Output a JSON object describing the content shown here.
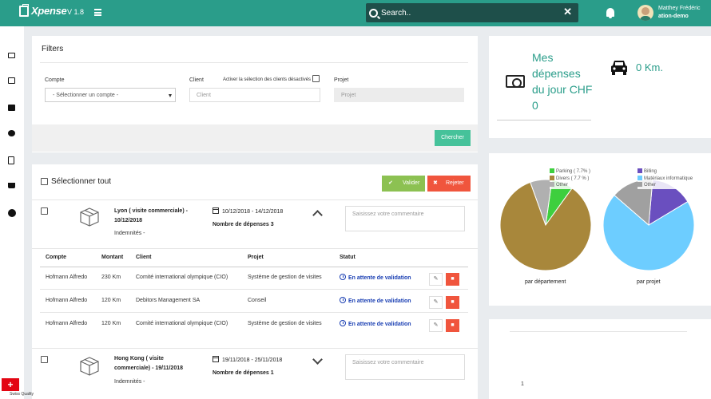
{
  "app": {
    "name": "Xpense",
    "version": "V 1.8"
  },
  "search": {
    "placeholder": "Search.."
  },
  "user": {
    "name": "Matthey Frédéric",
    "org": "ation-demo"
  },
  "filters": {
    "title": "Filters",
    "compte_label": "Compte",
    "compte_value": "- Sélectionner un compte -",
    "client_label": "Client",
    "client_placeholder": "Client",
    "activer_label": "Activer la sélection des clients désactivés",
    "projet_label": "Projet",
    "projet_placeholder": "Projet",
    "search_button": "Chercher"
  },
  "list": {
    "select_all": "Sélectionner tout",
    "validate": "Valider",
    "reject": "Rejeter",
    "comment_placeholder": "Saisissez votre commentaire",
    "table_headers": [
      "Compte",
      "Montant",
      "Client",
      "Projet",
      "Statut"
    ],
    "expenses": [
      {
        "title": "Lyon ( visite commerciale) - 10/12/2018",
        "sub": "Indemnités -",
        "dates": "10/12/2018 - 14/12/2018",
        "count": "Nombre de dépenses 3",
        "rows": [
          {
            "compte": "Hofmann Alfredo",
            "montant": "230 Km",
            "client": "Comité international olympique (CIO)",
            "projet": "Système de gestion de visites",
            "statut": "En attente de validation"
          },
          {
            "compte": "Hofmann Alfredo",
            "montant": "120 Km",
            "client": "Debitors Management SA",
            "projet": "Conseil",
            "statut": "En attente de validation"
          },
          {
            "compte": "Hofmann Alfredo",
            "montant": "120 Km",
            "client": "Comité international olympique (CIO)",
            "projet": "Système de gestion de visites",
            "statut": "En attente de validation"
          }
        ]
      },
      {
        "title": "Hong Kong ( visite commerciale) - 19/11/2018",
        "sub": "Indemnités -",
        "dates": "19/11/2018 - 25/11/2018",
        "count": "Nombre de dépenses 1",
        "rows": []
      }
    ]
  },
  "kpi": {
    "expenses_label": "Mes dépenses du jour CHF 0",
    "km": "0 Km."
  },
  "chart_data": [
    {
      "type": "pie",
      "caption": "par département",
      "slices": [
        {
          "label": "Parking ( 7.7% )",
          "value": 7.7,
          "color": "#3ecf3e"
        },
        {
          "label": "Divers ( 7.7 % )",
          "value": 84.6,
          "color": "#a8873b"
        },
        {
          "label": "Other",
          "value": 7.7,
          "color": "#b0b0b0"
        }
      ],
      "legend": [
        "Parking ( 7.7% )",
        "Divers ( 7.7 % )",
        "Other"
      ]
    },
    {
      "type": "pie",
      "caption": "par projet",
      "slices": [
        {
          "label": "Billing",
          "value": 15,
          "color": "#6a4fbf"
        },
        {
          "label": "Matériaux informatique",
          "value": 70,
          "color": "#6dcdff"
        },
        {
          "label": "Other",
          "value": 15,
          "color": "#a0a0a0"
        }
      ],
      "legend": [
        "Billing",
        "Matériaux informatique",
        "Other"
      ]
    }
  ],
  "bottom_panel": {
    "value": "1"
  },
  "footer": {
    "badge": "Swiss Quality"
  }
}
